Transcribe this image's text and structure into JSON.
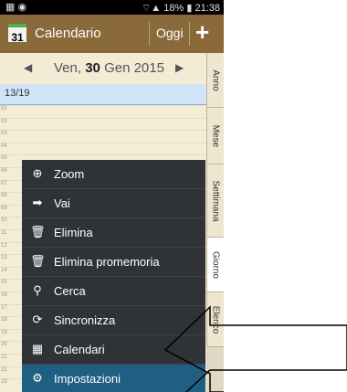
{
  "status_bar": {
    "time": "21:38",
    "battery": "18%"
  },
  "action_bar": {
    "calendar_day": "31",
    "title": "Calendario",
    "today_label": "Oggi",
    "add_label": "+"
  },
  "date_nav": {
    "weekday": "Ven,",
    "day": "30",
    "month_year": "Gen 2015"
  },
  "allday_row": "13/19",
  "hours": [
    "01",
    "02",
    "03",
    "04",
    "05",
    "06",
    "07",
    "08",
    "09",
    "10",
    "11",
    "12",
    "13",
    "14",
    "15",
    "16",
    "17",
    "18",
    "19",
    "20",
    "21",
    "22",
    "23"
  ],
  "tabs": [
    "Anno",
    "Mese",
    "Settimana",
    "Giorno",
    "Elenco"
  ],
  "menu": {
    "items": [
      {
        "label": "Zoom"
      },
      {
        "label": "Vai"
      },
      {
        "label": "Elimina"
      },
      {
        "label": "Elimina promemoria"
      },
      {
        "label": "Cerca"
      },
      {
        "label": "Sincronizza"
      },
      {
        "label": "Calendari"
      },
      {
        "label": "Impostazioni"
      }
    ]
  },
  "colors": {
    "actionbar": "#8a6a3a",
    "menu_bg": "#2f3338",
    "menu_highlight": "#1f5f82",
    "allday": "#cfe4f6"
  }
}
